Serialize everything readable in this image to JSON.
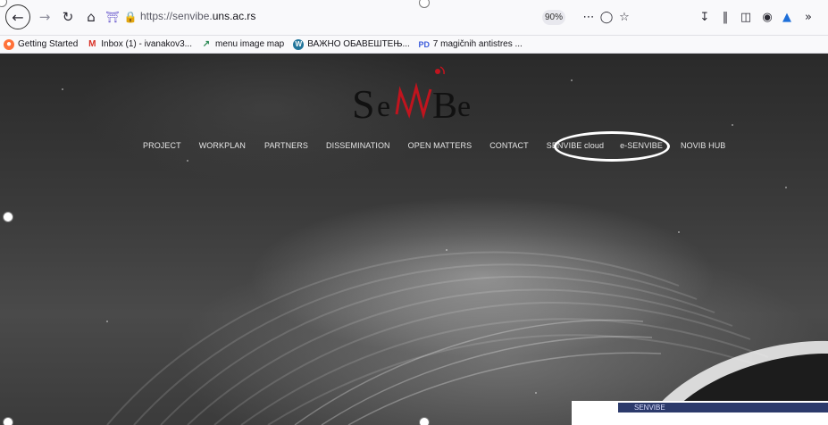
{
  "browser": {
    "url_prefix": "https://senvibe.",
    "url_domain": "uns.ac.rs",
    "zoom": "90%",
    "icons": [
      "back-icon",
      "forward-icon",
      "reload-icon",
      "home-icon",
      "shield-icon",
      "lock-icon",
      "more-icon",
      "pocket-icon",
      "bookmark-star-icon",
      "downloads-icon",
      "library-icon",
      "sidebar-icon",
      "account-icon",
      "extension-icon",
      "overflow-icon"
    ]
  },
  "bookmarks": [
    {
      "label": "Getting Started",
      "icon": "firefox-icon"
    },
    {
      "label": "Inbox (1) - ivanakov3...",
      "icon": "gmail-icon"
    },
    {
      "label": "menu image map",
      "icon": "imagemap-icon"
    },
    {
      "label": "ВАЖНО ОБАВЕШТЕЊ...",
      "icon": "wordpress-icon"
    },
    {
      "label": "7 magičnih antistres ...",
      "icon": "pinterest-icon"
    }
  ],
  "site": {
    "logo_text": "SeNVIBe",
    "nav": [
      "PROJECT",
      "WORKPLAN",
      "PARTNERS",
      "DISSEMINATION",
      "OPEN MATTERS",
      "CONTACT",
      "SENVIBE cloud",
      "e-SENVIBE",
      "NOVIB HUB"
    ],
    "highlighted_item": "e-SENVIBE",
    "accent": "#c0141e"
  },
  "overlay": {
    "label": "SENVIBE"
  }
}
